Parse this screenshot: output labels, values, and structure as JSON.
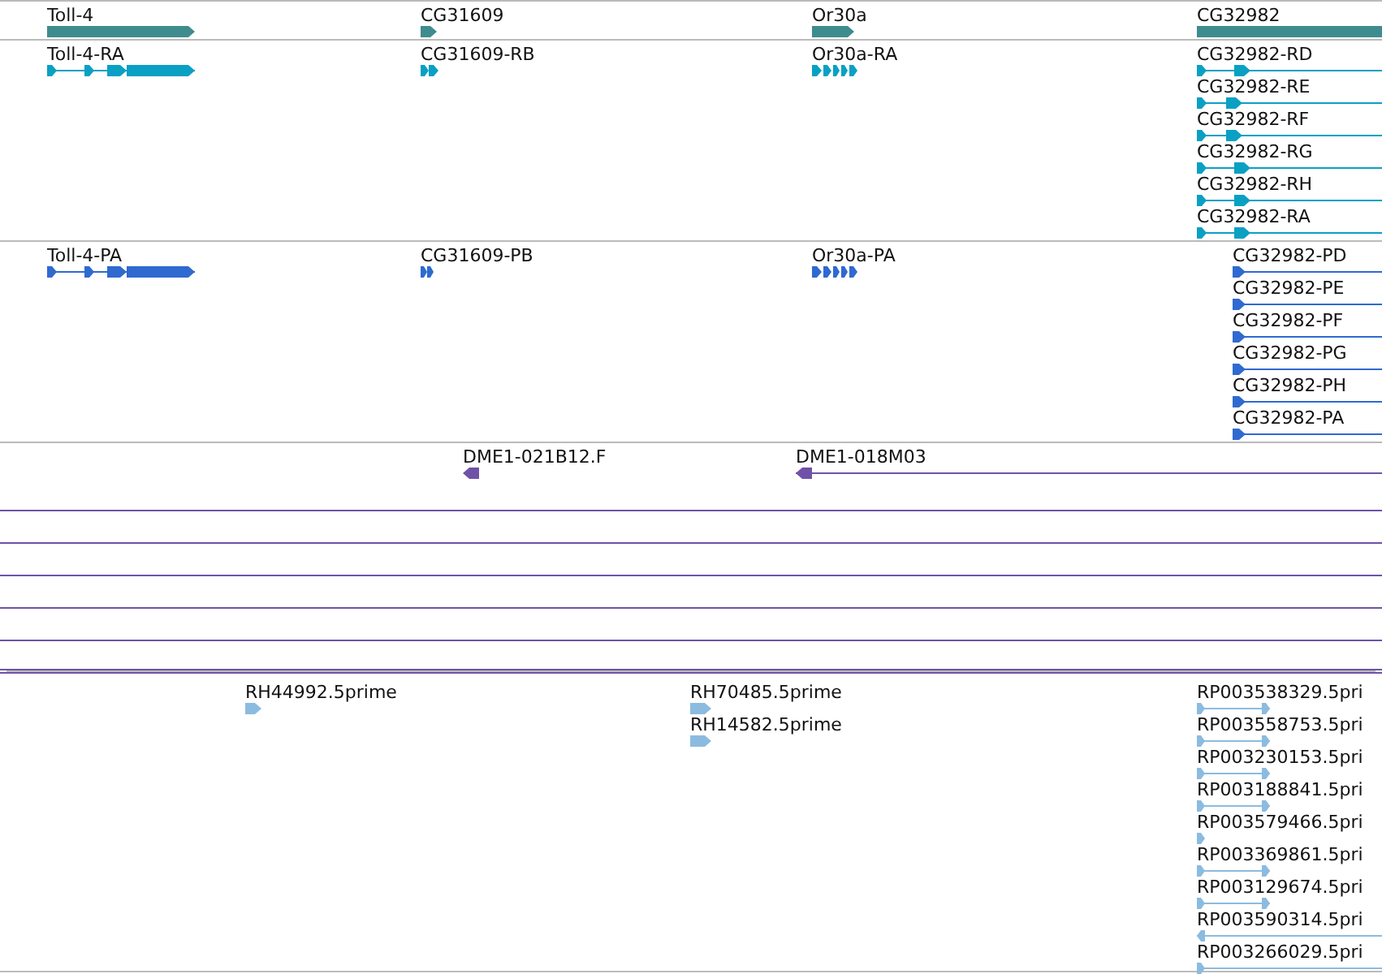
{
  "tracks": [
    {
      "kind": "gene",
      "features": [
        {
          "label": "Toll-4"
        },
        {
          "label": "CG31609"
        },
        {
          "label": "Or30a"
        },
        {
          "label": "CG32982"
        }
      ]
    },
    {
      "kind": "transcript",
      "features": [
        {
          "label": "Toll-4-RA"
        },
        {
          "label": "CG31609-RB"
        },
        {
          "label": "Or30a-RA"
        },
        {
          "label": "CG32982-RD"
        },
        {
          "label": "CG32982-RE"
        },
        {
          "label": "CG32982-RF"
        },
        {
          "label": "CG32982-RG"
        },
        {
          "label": "CG32982-RH"
        },
        {
          "label": "CG32982-RA"
        }
      ]
    },
    {
      "kind": "protein",
      "features": [
        {
          "label": "Toll-4-PA"
        },
        {
          "label": "CG31609-PB"
        },
        {
          "label": "Or30a-PA"
        },
        {
          "label": "CG32982-PD"
        },
        {
          "label": "CG32982-PE"
        },
        {
          "label": "CG32982-PF"
        },
        {
          "label": "CG32982-PG"
        },
        {
          "label": "CG32982-PH"
        },
        {
          "label": "CG32982-PA"
        }
      ]
    },
    {
      "kind": "clone",
      "features": [
        {
          "label": "DME1-021B12.F"
        },
        {
          "label": "DME1-018M03"
        },
        {
          "kind": "span"
        },
        {
          "kind": "span"
        },
        {
          "kind": "span"
        },
        {
          "kind": "span"
        },
        {
          "kind": "span"
        },
        {
          "kind": "span"
        }
      ]
    },
    {
      "kind": "est",
      "features": [
        {
          "label": "RH44992.5prime"
        },
        {
          "label": "RH70485.5prime"
        },
        {
          "label": "RH14582.5prime"
        },
        {
          "label": "RP003538329.5pri"
        },
        {
          "label": "RP003558753.5pri"
        },
        {
          "label": "RP003230153.5pri"
        },
        {
          "label": "RP003188841.5pri"
        },
        {
          "label": "RP003579466.5pri"
        },
        {
          "label": "RP003369861.5pri"
        },
        {
          "label": "RP003129674.5pri"
        },
        {
          "label": "RP003590314.5pri"
        },
        {
          "label": "RP003266029.5pri"
        }
      ]
    }
  ]
}
